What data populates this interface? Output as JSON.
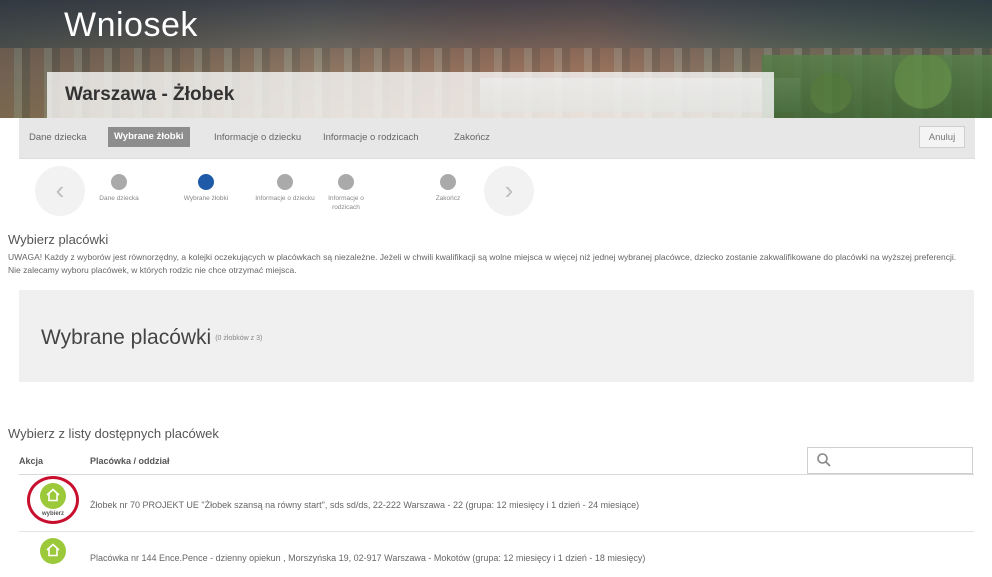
{
  "header": {
    "app_title": "Wniosek",
    "city_title": "Warszawa - Żłobek"
  },
  "tabs": [
    {
      "label": "Dane dziecka",
      "active": false
    },
    {
      "label": "Wybrane żłobki",
      "active": true
    },
    {
      "label": "Informacje o dziecku",
      "active": false
    },
    {
      "label": "Informacje o rodzicach",
      "active": false
    },
    {
      "label": "Zakończ",
      "active": false
    }
  ],
  "cancel_label": "Anuluj",
  "stepper": {
    "prev_icon": "chevron-left-icon",
    "next_icon": "chevron-right-icon",
    "steps": [
      {
        "label": "Dane dziecka",
        "active": false
      },
      {
        "label": "Wybrane żłobki",
        "active": true
      },
      {
        "label": "Informacje o dziecku",
        "active": false
      },
      {
        "label": "Informacje o rodzicach",
        "active": false
      },
      {
        "label": "Zakończ",
        "active": false
      }
    ]
  },
  "section": {
    "title": "Wybierz placówki",
    "warning": "UWAGA! Każdy z wyborów jest równorzędny, a kolejki oczekujących w placówkach są niezależne. Jeżeli w chwili kwalifikacji są wolne miejsca w więcej niż jednej wybranej placówce, dziecko zostanie zakwalifikowane do placówki na wyższej preferencji. Nie zalecamy wyboru placówek, w których rodzic nie chce otrzymać miejsca."
  },
  "chosen": {
    "title": "Wybrane placówki",
    "count": "(0 żłobków z 3)"
  },
  "list": {
    "title": "Wybierz z listy dostępnych placówek",
    "col_action": "Akcja",
    "col_place": "Placówka / oddział",
    "search_placeholder": "",
    "rows": [
      {
        "text": "Żłobek nr 70 PROJEKT UE \"Żłobek szansą na równy start\", sds sd/ds, 22-222 Warszawa - 22 (grupa: 12 miesięcy i 1 dzień - 24 miesiące)",
        "button_label": "wybierz",
        "highlighted": true
      },
      {
        "text": "Placówka nr 144 Ence.Pence - dzienny opiekun , Morszyńska 19, 02-917 Warszawa - Mokotów (grupa: 12 miesięcy i 1 dzień - 18 miesięcy)",
        "button_label": "wybierz",
        "highlighted": false
      }
    ]
  },
  "colors": {
    "accent_blue": "#1e5aa8",
    "pick_green": "#9bc93a",
    "highlight_red": "#c8102e",
    "active_tab": "#8d8d8d"
  }
}
